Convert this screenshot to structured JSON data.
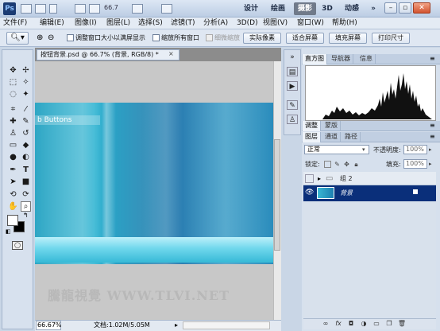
{
  "title_bar": {
    "logo": "Ps",
    "zoom_value": "66.7",
    "workspaces": [
      "设计",
      "绘画",
      "摄影",
      "3D",
      "动感"
    ],
    "active_workspace": "摄影",
    "window_controls": [
      "minimize-icon",
      "restore-icon",
      "close-icon"
    ]
  },
  "menu": {
    "items": [
      "文件(F)",
      "编辑(E)",
      "图像(I)",
      "图层(L)",
      "选择(S)",
      "滤镜(T)",
      "分析(A)",
      "3D(D)",
      "视图(V)",
      "窗口(W)",
      "帮助(H)"
    ]
  },
  "options_bar": {
    "tool_icon": "zoom-icon",
    "checkbox_resize": "调整窗口大小以满屏显示",
    "checkbox_zoom_all": "缩放所有窗口",
    "checkbox_scrubby": "细微缩放",
    "buttons": [
      "实际像素",
      "适合屏幕",
      "填充屏幕",
      "打印尺寸"
    ]
  },
  "document": {
    "tab_title": "按钮背景.psd @ 66.7% (背景, RGB/8) *",
    "close": "×",
    "banner_text": "b Buttons",
    "watermark": "騰龍視覺 WWW.TLVI.NET",
    "status_zoom": "66.67%",
    "status_doc": "文档:1.02M/5.05M"
  },
  "panels": {
    "histogram_tabs": [
      "直方图",
      "导航器",
      "信息"
    ],
    "adjust_tabs": [
      "调整",
      "蒙版"
    ],
    "layers_tabs": [
      "图层",
      "通道",
      "路径"
    ],
    "blend_mode": "正常",
    "opacity_label": "不透明度:",
    "opacity_value": "100%",
    "lock_label": "锁定:",
    "fill_label": "填充:",
    "fill_value": "100%",
    "layers": [
      {
        "name": "组 2",
        "type": "group",
        "visible": false
      },
      {
        "name": "背景",
        "type": "background",
        "visible": true,
        "selected": true
      }
    ],
    "footer_icons": [
      "link-icon",
      "fx-icon",
      "mask-icon",
      "adjustment-icon",
      "folder-icon",
      "new-layer-icon",
      "trash-icon"
    ]
  },
  "colors": {
    "selected_layer": "#0a2f7a",
    "canvas_cyan": "#2ea6c4"
  }
}
